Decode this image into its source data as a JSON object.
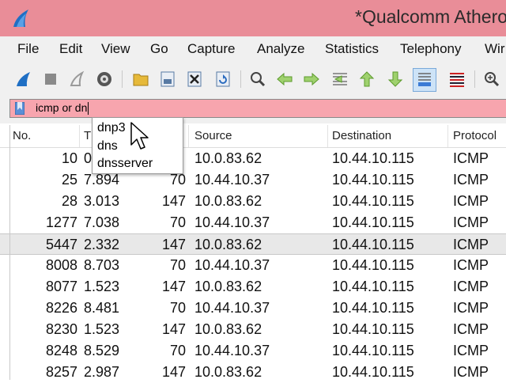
{
  "window": {
    "title": "*Qualcomm Athero"
  },
  "menu": [
    "File",
    "Edit",
    "View",
    "Go",
    "Capture",
    "Analyze",
    "Statistics",
    "Telephony",
    "Wir"
  ],
  "toolbar": {
    "icons": [
      "shark-fin-icon",
      "stop-icon",
      "restart-fin-icon",
      "capture-options-icon",
      "open-folder-icon",
      "save-file-icon",
      "close-file-icon",
      "reload-icon",
      "find-icon",
      "go-back-icon",
      "go-forward-icon",
      "go-to-packet-icon",
      "go-first-icon",
      "go-last-icon",
      "autoscroll-icon",
      "colorize-icon",
      "zoom-in-icon"
    ]
  },
  "filter": {
    "value": "icmp or dn",
    "background": "#f7a5ae"
  },
  "autocomplete": [
    "dnp3",
    "dns",
    "dnsserver"
  ],
  "columns": [
    "No.",
    "T",
    "Source",
    "Destination",
    "Protocol"
  ],
  "rows": [
    {
      "no": "10",
      "time": "0",
      "length": "",
      "source": "10.0.83.62",
      "destination": "10.44.10.115",
      "protocol": "ICMP"
    },
    {
      "no": "25",
      "time": "7.894",
      "length": "70",
      "source": "10.44.10.37",
      "destination": "10.44.10.115",
      "protocol": "ICMP"
    },
    {
      "no": "28",
      "time": "3.013",
      "length": "147",
      "source": "10.0.83.62",
      "destination": "10.44.10.115",
      "protocol": "ICMP"
    },
    {
      "no": "1277",
      "time": "7.038",
      "length": "70",
      "source": "10.44.10.37",
      "destination": "10.44.10.115",
      "protocol": "ICMP"
    },
    {
      "no": "5447",
      "time": "2.332",
      "length": "147",
      "source": "10.0.83.62",
      "destination": "10.44.10.115",
      "protocol": "ICMP"
    },
    {
      "no": "8008",
      "time": "8.703",
      "length": "70",
      "source": "10.44.10.37",
      "destination": "10.44.10.115",
      "protocol": "ICMP"
    },
    {
      "no": "8077",
      "time": "1.523",
      "length": "147",
      "source": "10.0.83.62",
      "destination": "10.44.10.115",
      "protocol": "ICMP"
    },
    {
      "no": "8226",
      "time": "8.481",
      "length": "70",
      "source": "10.44.10.37",
      "destination": "10.44.10.115",
      "protocol": "ICMP"
    },
    {
      "no": "8230",
      "time": "1.523",
      "length": "147",
      "source": "10.0.83.62",
      "destination": "10.44.10.115",
      "protocol": "ICMP"
    },
    {
      "no": "8248",
      "time": "8.529",
      "length": "70",
      "source": "10.44.10.37",
      "destination": "10.44.10.115",
      "protocol": "ICMP"
    },
    {
      "no": "8257",
      "time": "2.987",
      "length": "147",
      "source": "10.0.83.62",
      "destination": "10.44.10.115",
      "protocol": "ICMP"
    }
  ]
}
